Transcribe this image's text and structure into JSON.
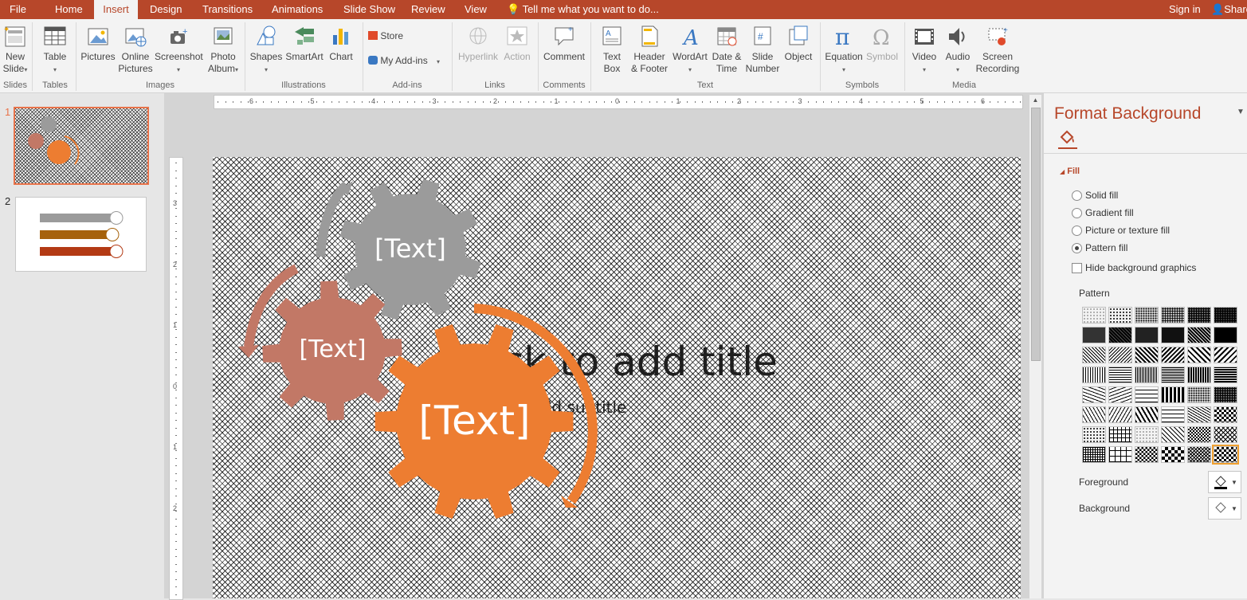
{
  "tabs": [
    "File",
    "Home",
    "Insert",
    "Design",
    "Transitions",
    "Animations",
    "Slide Show",
    "Review",
    "View"
  ],
  "active_tab": "Insert",
  "tell_me": "Tell me what you want to do...",
  "sign_in": "Sign in",
  "share": "Share",
  "ribbon": {
    "new_slide_1": "New",
    "new_slide_2": "Slide",
    "table": "Table",
    "pictures": "Pictures",
    "online_pictures_1": "Online",
    "online_pictures_2": "Pictures",
    "screenshot": "Screenshot",
    "photo_album_1": "Photo",
    "photo_album_2": "Album",
    "shapes": "Shapes",
    "smartart": "SmartArt",
    "chart": "Chart",
    "store": "Store",
    "my_addins": "My Add-ins",
    "hyperlink": "Hyperlink",
    "action": "Action",
    "comment": "Comment",
    "text_box_1": "Text",
    "text_box_2": "Box",
    "header_footer_1": "Header",
    "header_footer_2": "& Footer",
    "wordart": "WordArt",
    "date_time_1": "Date &",
    "date_time_2": "Time",
    "slide_number_1": "Slide",
    "slide_number_2": "Number",
    "object": "Object",
    "equation": "Equation",
    "symbol": "Symbol",
    "video": "Video",
    "audio": "Audio",
    "screen_recording_1": "Screen",
    "screen_recording_2": "Recording",
    "groups": {
      "slides": "Slides",
      "tables": "Tables",
      "images": "Images",
      "illustrations": "Illustrations",
      "addins": "Add-ins",
      "links": "Links",
      "comments": "Comments",
      "text": "Text",
      "symbols": "Symbols",
      "media": "Media"
    }
  },
  "thumbnails": [
    {
      "num": "1"
    },
    {
      "num": "2"
    }
  ],
  "hruler_labels": [
    "6",
    "5",
    "4",
    "3",
    "2",
    "1",
    "0",
    "1",
    "2",
    "3",
    "4",
    "5",
    "6"
  ],
  "vruler_labels": [
    "3",
    "2",
    "1",
    "0",
    "1",
    "2"
  ],
  "slide": {
    "title_placeholder": "Click to add title",
    "subtitle_placeholder": "Click to add subtitle",
    "gear_gray": "[Text]",
    "gear_rose": "[Text]",
    "gear_orange": "[Text]"
  },
  "format_pane": {
    "title": "Format Background",
    "section": "Fill",
    "options": [
      "Solid fill",
      "Gradient fill",
      "Picture or texture fill",
      "Pattern fill"
    ],
    "selected_option": "Pattern fill",
    "hide_bg": "Hide background graphics",
    "pattern_label": "Pattern",
    "foreground_label": "Foreground",
    "background_label": "Background"
  },
  "colors": {
    "accent": "#b7472a",
    "gear_gray": "#9b9b9b",
    "gear_rose": "#c27866",
    "gear_orange": "#ed7d31"
  }
}
